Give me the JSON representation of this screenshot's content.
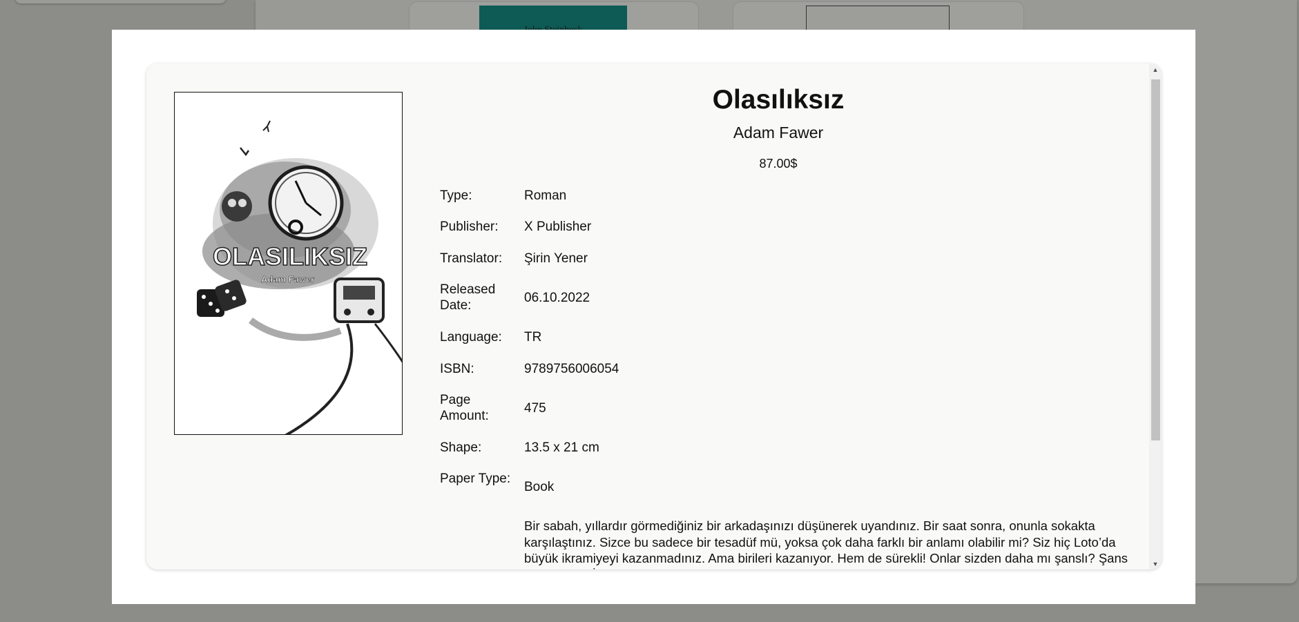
{
  "background": {
    "partial_cover_text": "John Steinbeck"
  },
  "book": {
    "title": "Olasılıksız",
    "author": "Adam Fawer",
    "price": "87.00$",
    "cover": {
      "title_text": "OLASILIKSIZ",
      "author_text": "Adam Fawer"
    },
    "specs": [
      {
        "label": "Type:",
        "value": "Roman"
      },
      {
        "label": "Publisher:",
        "value": "X Publisher"
      },
      {
        "label": "Translator:",
        "value": "Şirin Yener"
      },
      {
        "label": "Released Date:",
        "value": "06.10.2022"
      },
      {
        "label": "Language:",
        "value": "TR"
      },
      {
        "label": "ISBN:",
        "value": "9789756006054"
      },
      {
        "label": "Page Amount:",
        "value": "475"
      },
      {
        "label": "Shape:",
        "value": "13.5 x 21 cm"
      },
      {
        "label": "Paper Type:",
        "value": "Book"
      }
    ],
    "description": "Bir sabah, yıllardır görmediğiniz bir arkadaşınızı düşünerek uyandınız. Bir saat sonra, onunla sokakta karşılaştınız. Sizce bu sadece bir tesadüf mü, yoksa çok daha farklı bir anlamı olabilir mi? Siz hiç Loto’da büyük ikramiyeyi kazanmadınız. Ama birileri kazanıyor. Hem de sürekli! Onlar sizden daha mı şanslı? Şans neydi peki? İşin içinde bütün ihtimalleri hesaplayarak"
  },
  "colors": {
    "overlay": "#8c8c88",
    "card_bg": "#f9f9f7",
    "text": "#111111"
  },
  "icons": {
    "scroll_up": "scroll-up-arrow-icon",
    "scroll_down": "scroll-down-arrow-icon"
  }
}
